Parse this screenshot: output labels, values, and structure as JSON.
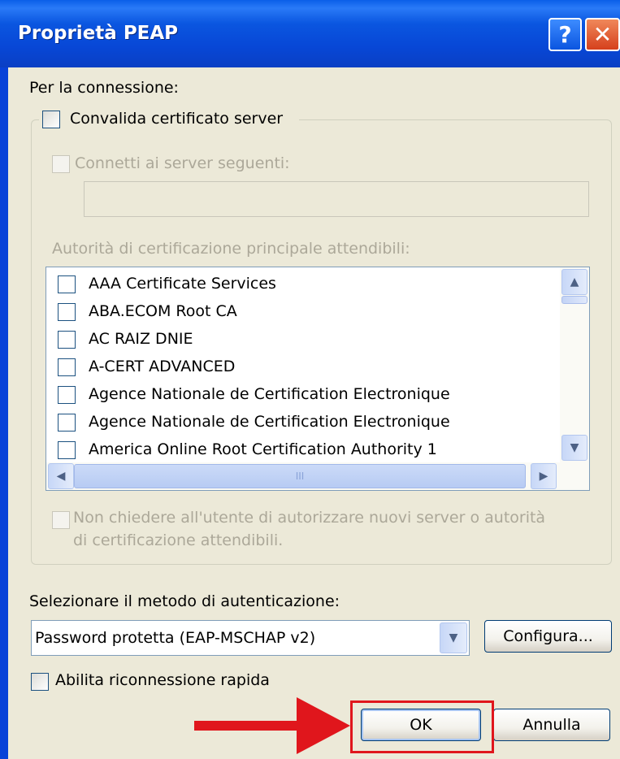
{
  "window": {
    "title": "Proprietà PEAP",
    "help_icon": "?",
    "close_icon": "✕"
  },
  "connection_label": "Per la connessione:",
  "validate_server_cert": {
    "label": "Convalida certificato server",
    "checked": false
  },
  "connect_to_servers": {
    "label": "Connetti ai server seguenti:",
    "checked": false,
    "value": ""
  },
  "trusted_roots": {
    "label": "Autorità di certificazione principale attendibili:",
    "items": [
      "AAA Certificate Services",
      "ABA.ECOM Root CA",
      "AC RAIZ DNIE",
      "A-CERT ADVANCED",
      "Agence Nationale de Certification Electronique",
      "Agence Nationale de Certification Electronique",
      "America Online Root Certification Authority 1"
    ],
    "scroll_up": "▲",
    "scroll_down": "▼",
    "scroll_left": "◀",
    "scroll_right": "▶",
    "grip": "III"
  },
  "no_prompt": {
    "line1": "Non chiedere all'utente di autorizzare nuovi server o autorità",
    "line2": "di certificazione attendibili.",
    "checked": false
  },
  "auth_method": {
    "label": "Selezionare il metodo di autenticazione:",
    "value": "Password protetta (EAP-MSCHAP v2)",
    "arrow": "▼"
  },
  "configure_button": "Configura...",
  "fast_reconnect": {
    "label": "Abilita riconnessione rapida",
    "checked": false
  },
  "ok_button": "OK",
  "cancel_button": "Annulla",
  "colors": {
    "title_bar": "#0842d8",
    "dialog_bg": "#ece9d8",
    "annotation_red": "#e0161c"
  }
}
